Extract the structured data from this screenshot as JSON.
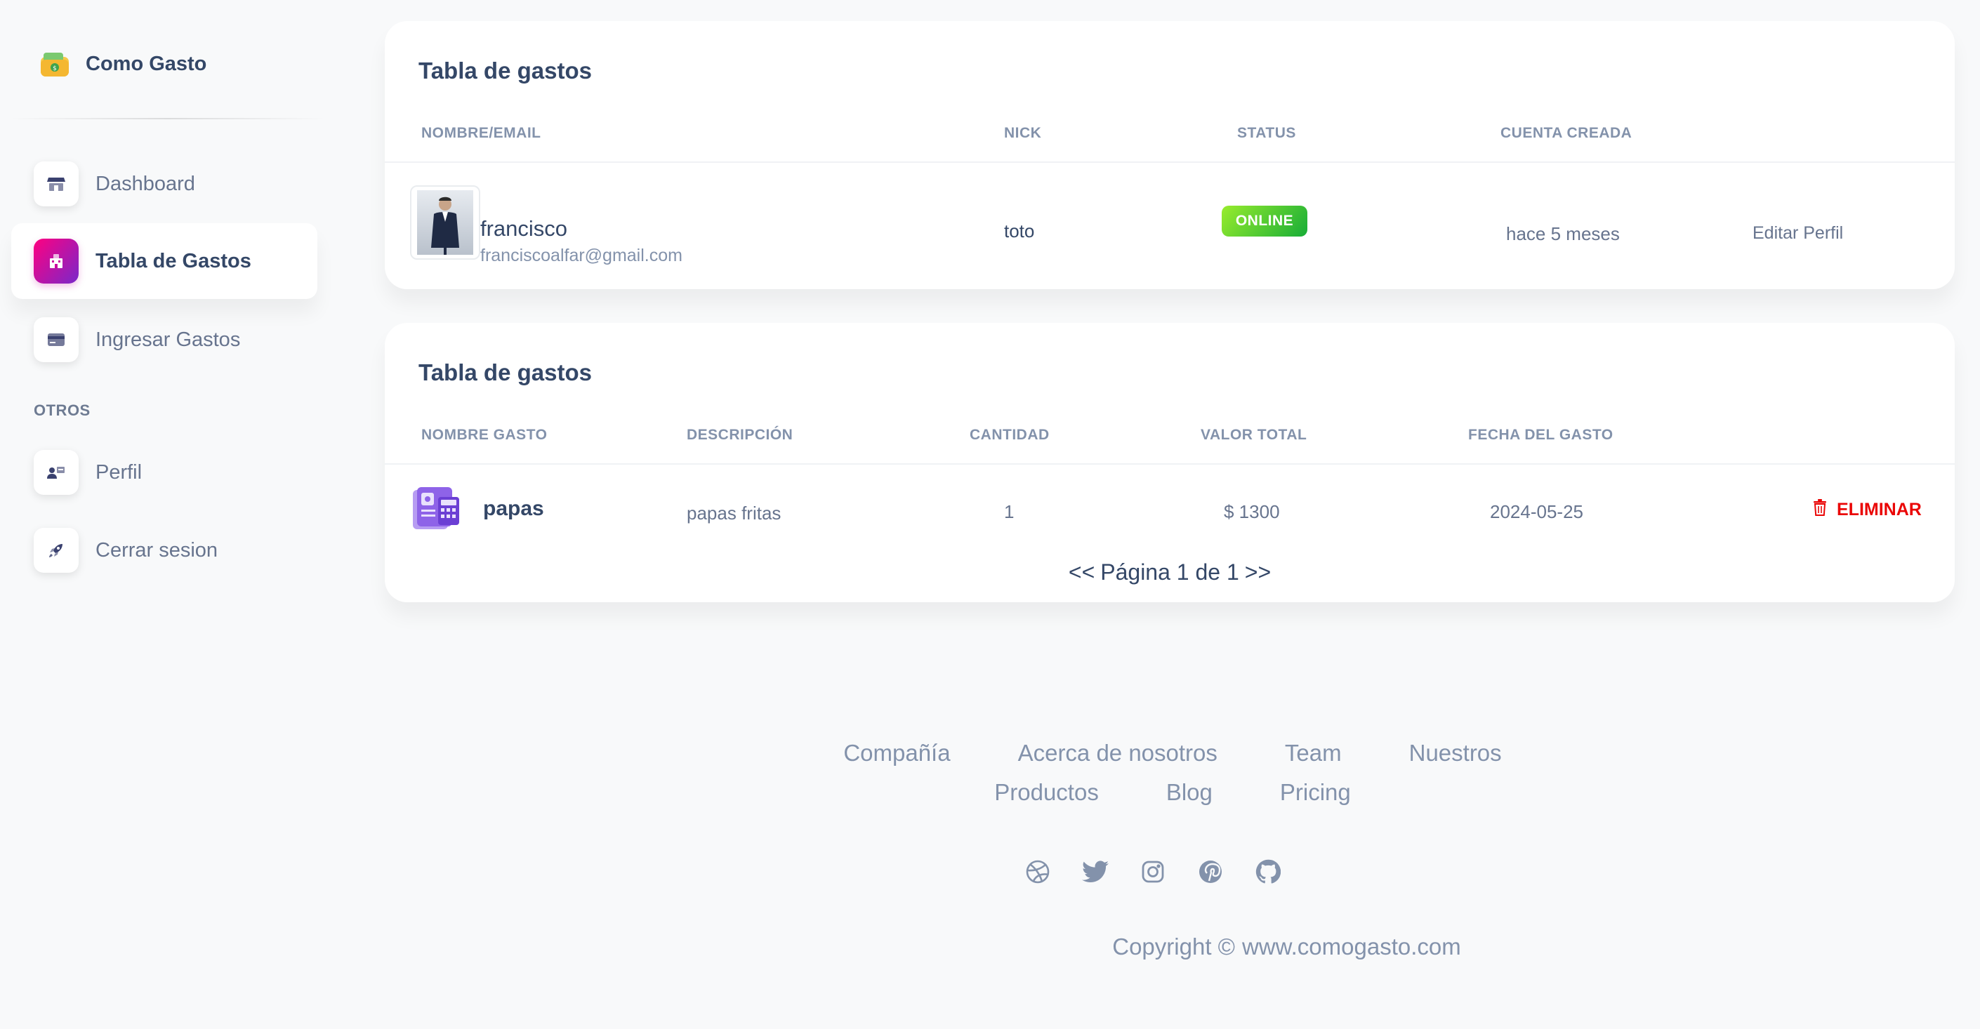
{
  "brand": {
    "name": "Como Gasto",
    "logo_icon": "wallet-icon"
  },
  "sidebar": {
    "items": [
      {
        "label": "Dashboard",
        "icon": "shop-icon",
        "active": false
      },
      {
        "label": "Tabla de Gastos",
        "icon": "office-icon",
        "active": true
      },
      {
        "label": "Ingresar Gastos",
        "icon": "credit-card-icon",
        "active": false
      }
    ],
    "section_label": "OTROS",
    "other_items": [
      {
        "label": "Perfil",
        "icon": "user-card-icon"
      },
      {
        "label": "Cerrar sesion",
        "icon": "rocket-icon"
      }
    ]
  },
  "users_table": {
    "title": "Tabla de gastos",
    "headers": [
      "NOMBRE/EMAIL",
      "NICK",
      "STATUS",
      "CUENTA CREADA"
    ],
    "rows": [
      {
        "name": "francisco",
        "email": "franciscoalfar@gmail.com",
        "nick": "toto",
        "status": "ONLINE",
        "created": "hace 5 meses",
        "action": "Editar Perfil"
      }
    ]
  },
  "expenses_table": {
    "title": "Tabla de gastos",
    "headers": [
      "NOMBRE GASTO",
      "DESCRIPCIÓN",
      "CANTIDAD",
      "VALOR TOTAL",
      "FECHA DEL GASTO"
    ],
    "rows": [
      {
        "name": "papas",
        "description": "papas fritas",
        "quantity": "1",
        "total": "$ 1300",
        "date": "2024-05-25",
        "action": "ELIMINAR"
      }
    ],
    "pager": {
      "prev": "<<",
      "text": "Página 1 de 1",
      "next": ">>"
    }
  },
  "footer": {
    "links": [
      "Compañía",
      "Acerca de nosotros",
      "Team",
      "Nuestros",
      "Productos",
      "Blog",
      "Pricing"
    ],
    "social": [
      "dribbble-icon",
      "twitter-icon",
      "instagram-icon",
      "pinterest-icon",
      "github-icon"
    ],
    "copyright": "Copyright ©",
    "site": "www.comogasto.com"
  },
  "colors": {
    "accent_gradient_start": "#7928ca",
    "accent_gradient_end": "#ff0080",
    "online_start": "#17ad37",
    "online_end": "#98ec2d",
    "danger": "#ea0606",
    "text_dark": "#344767",
    "text_muted": "#8392ab"
  }
}
